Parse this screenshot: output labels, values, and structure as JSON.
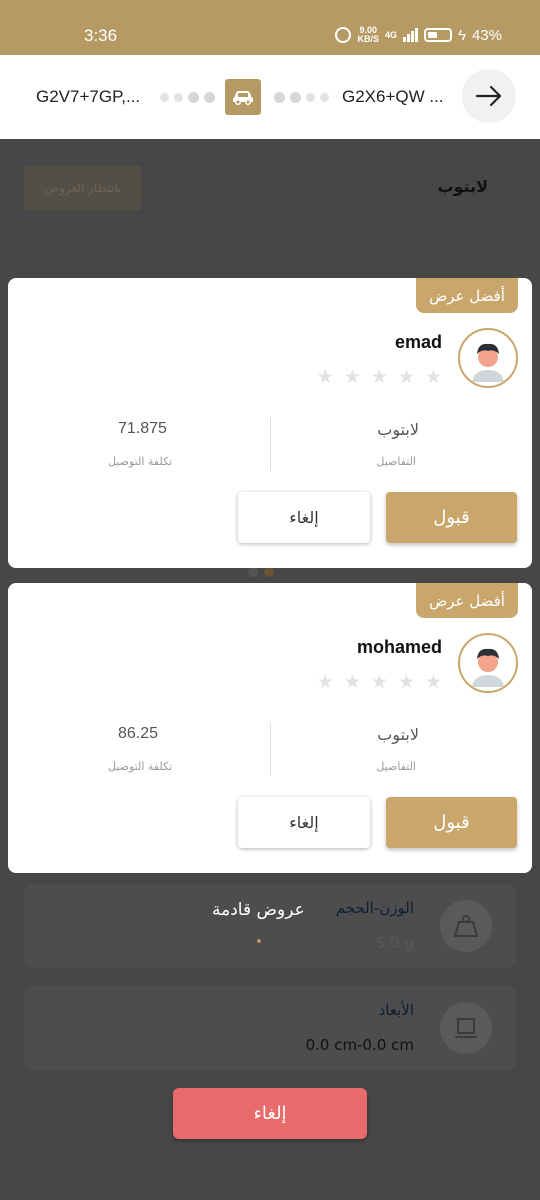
{
  "status_bar": {
    "time": "3:36",
    "speed_top": "9.00",
    "speed_bottom": "KB/S",
    "network": "4G",
    "battery": "43%"
  },
  "route": {
    "from": "G2V7+7GP,...",
    "to": "G2X6+QW ...",
    "vehicle_icon": "car-icon",
    "next_icon": "arrow-right-icon"
  },
  "background": {
    "title": "لابتوب",
    "waiting_label": "بانتظار العروض",
    "weight": {
      "label": "الوزن-الحجم",
      "value": "5.0 g",
      "icon": "kg-weight-icon"
    },
    "dimensions": {
      "label": "الأبعاد",
      "value": "0.0 cm-0.0 cm",
      "icon": "box-icon"
    },
    "incoming_offers": "عروض قادمة",
    "cancel_label": "إلغاء"
  },
  "offers": [
    {
      "badge": "أفضل عرض",
      "name": "emad",
      "rating": 0,
      "details_value": "لابتوب",
      "details_label": "التفاصيل",
      "cost_value": "71.875",
      "cost_label": "تكلفة التوصيل",
      "accept_label": "قبول",
      "reject_label": "إلغاء"
    },
    {
      "badge": "أفضل عرض",
      "name": "mohamed",
      "rating": 0,
      "details_value": "لابتوب",
      "details_label": "التفاصيل",
      "cost_value": "86.25",
      "cost_label": "تكلفة التوصيل",
      "accept_label": "قبول",
      "reject_label": "إلغاء"
    }
  ],
  "colors": {
    "accent": "#c9a76c",
    "status_bar": "#b59a64",
    "overlay": "#474747",
    "danger": "#e96a6b"
  }
}
